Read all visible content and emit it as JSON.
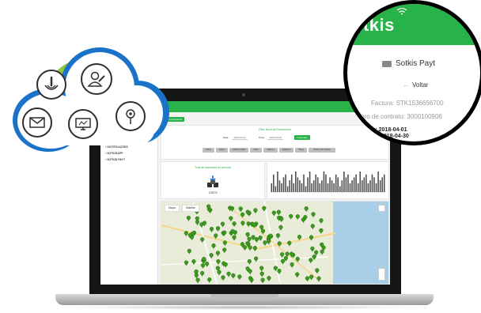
{
  "app": {
    "new_button": "Novo Lançamento",
    "sidebar_items": [
      "MEUS CONTRATOS",
      "NOTIFICAÇÕES",
      "SOTKISAPP",
      "SOTKIS PAYT"
    ],
    "filter": {
      "title": "Filtro Nível de Enchimento",
      "date_from_label": "Data:",
      "date_from": "2018-04-01",
      "date_to_label": "Para:",
      "date_to": "2018-04-30",
      "search_label": "Pesquisar",
      "types": [
        "Todos",
        "Papel",
        "Indiferenciado",
        "Vidro",
        "Plástico",
        "Orgânico",
        "Óleos",
        "Todos sem bateria"
      ]
    },
    "stats": {
      "title": "Total de depósitos do período",
      "count": "13075"
    },
    "map": {
      "tab_map": "Mapa",
      "tab_satellite": "Satélite"
    }
  },
  "zoom": {
    "brand": "otkis",
    "title": "Sotkis Payt",
    "back_label": "Voltar",
    "invoice": "Factura: STK1536656700",
    "contract": "úmero de contrato: 3000100906",
    "period_line1": "eríodo: 2018-04-01",
    "period_line2": "2018-04-30"
  },
  "colors": {
    "brand_green": "#27b24a",
    "cloud_blue": "#1a73c9",
    "cloud_green": "#8cc63f"
  },
  "icons": [
    "touch-icon",
    "user-icon",
    "mail-icon",
    "computer-icon",
    "location-pin-icon",
    "arrow-left-icon",
    "card-icon",
    "wifi-icon",
    "download-icon",
    "user-group-icon"
  ],
  "chart_data": {
    "type": "bar",
    "values": [
      3,
      6,
      2,
      7,
      4,
      3,
      5,
      6,
      2,
      4,
      6,
      3,
      7,
      5,
      4,
      3,
      6,
      2,
      5,
      7,
      3,
      4,
      6,
      5,
      3,
      4,
      7,
      6,
      3,
      5,
      4,
      3,
      6,
      5,
      2,
      4,
      7,
      5,
      6,
      3,
      4,
      5,
      6,
      3,
      7,
      4,
      5,
      6,
      3,
      4,
      6,
      5,
      3,
      7,
      4,
      5,
      6
    ]
  }
}
